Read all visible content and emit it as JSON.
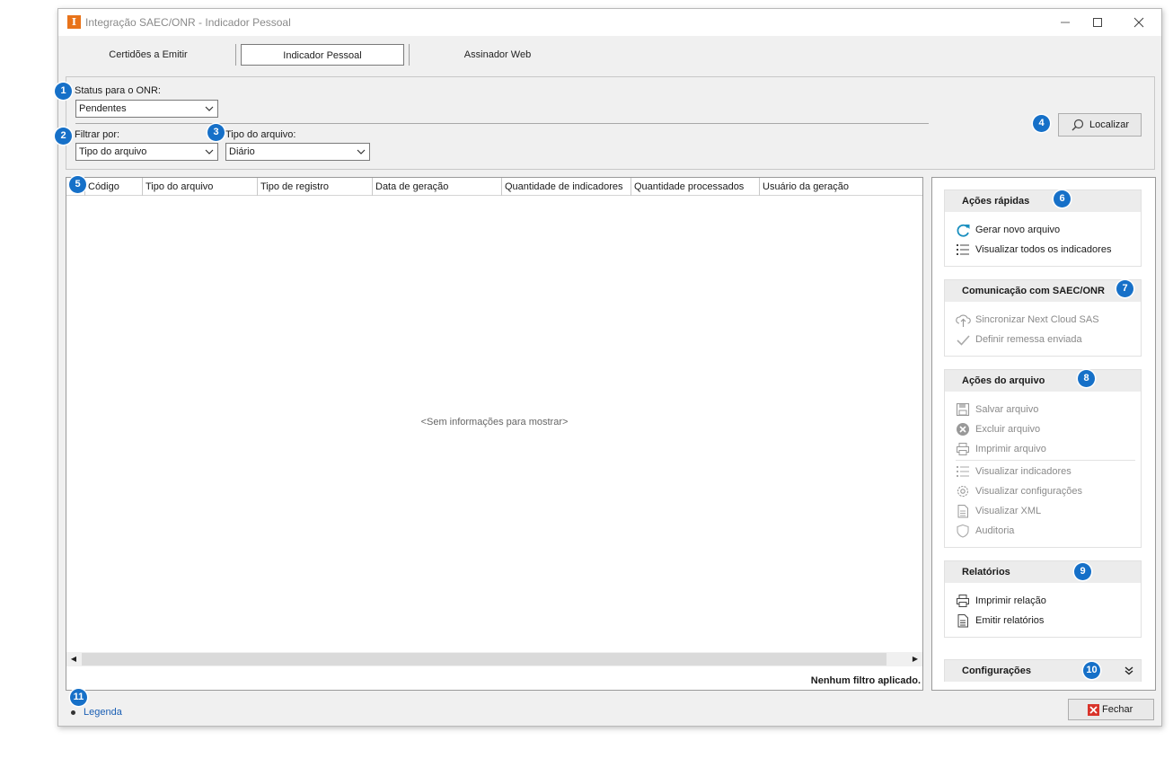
{
  "window": {
    "title": "Integração SAEC/ONR - Indicador Pessoal",
    "app_icon_letter": "I"
  },
  "tabs": [
    {
      "label": "Certidões a Emitir",
      "active": false
    },
    {
      "label": "Indicador Pessoal",
      "active": true
    },
    {
      "label": "Assinador Web",
      "active": false
    }
  ],
  "filters": {
    "status_label": "Status para o ONR:",
    "status_value": "Pendentes",
    "filter_by_label": "Filtrar por:",
    "filter_by_value": "Tipo do arquivo",
    "file_type_label": "Tipo do arquivo:",
    "file_type_value": "Diário",
    "search_button": "Localizar"
  },
  "grid": {
    "columns": [
      "Código",
      "Tipo do arquivo",
      "Tipo de registro",
      "Data de geração",
      "Quantidade de indicadores",
      "Quantidade processados",
      "Usuário da geração"
    ],
    "empty_message": "<Sem informações para mostrar>",
    "filter_status": "Nenhum filtro aplicado."
  },
  "side_panel": {
    "quick_actions": {
      "title": "Ações rápidas",
      "items": [
        "Gerar novo arquivo",
        "Visualizar todos os indicadores"
      ]
    },
    "communication": {
      "title": "Comunicação com SAEC/ONR",
      "items": [
        "Sincronizar Next Cloud SAS",
        "Definir remessa enviada"
      ]
    },
    "file_actions": {
      "title": "Ações do arquivo",
      "items": [
        "Salvar arquivo",
        "Excluir arquivo",
        "Imprimir arquivo",
        "Visualizar indicadores",
        "Visualizar configurações",
        "Visualizar XML",
        "Auditoria"
      ]
    },
    "reports": {
      "title": "Relatórios",
      "items": [
        "Imprimir relação",
        "Emitir relatórios"
      ]
    },
    "settings": {
      "title": "Configurações"
    }
  },
  "footer": {
    "legend_link": "Legenda",
    "close_button": "Fechar"
  },
  "badges": [
    "1",
    "2",
    "3",
    "4",
    "5",
    "6",
    "7",
    "8",
    "9",
    "10",
    "11"
  ],
  "colors": {
    "badge": "#1670c8",
    "accent_icon": "#1a8fbf",
    "app_icon": "#e8731a",
    "close_icon": "#d9342b",
    "link": "#1a5fb4"
  }
}
